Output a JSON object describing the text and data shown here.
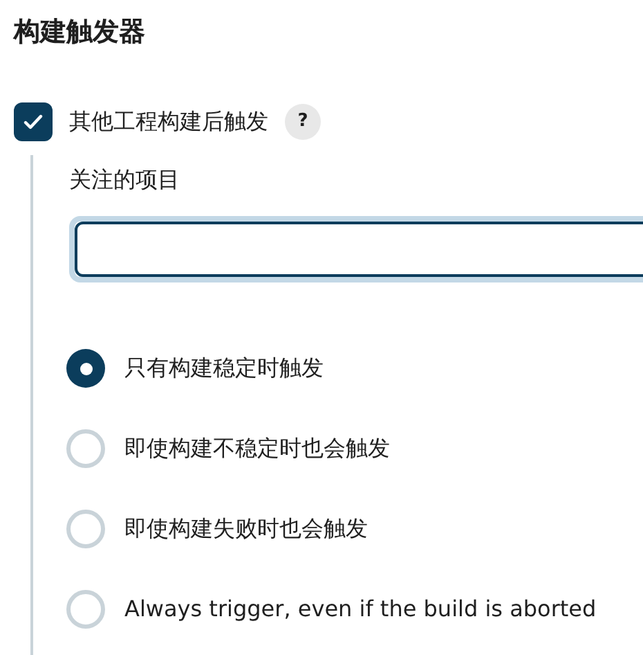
{
  "section_title": "构建触发器",
  "trigger": {
    "label": "其他工程构建后触发",
    "checked": true,
    "help": "?"
  },
  "watched_projects": {
    "label": "关注的项目",
    "focused": true
  },
  "options": [
    {
      "label": "只有构建稳定时触发",
      "selected": true
    },
    {
      "label": "即使构建不稳定时也会触发",
      "selected": false
    },
    {
      "label": "即使构建失败时也会触发",
      "selected": false
    },
    {
      "label": "Always trigger, even if the build is aborted",
      "selected": false
    }
  ]
}
